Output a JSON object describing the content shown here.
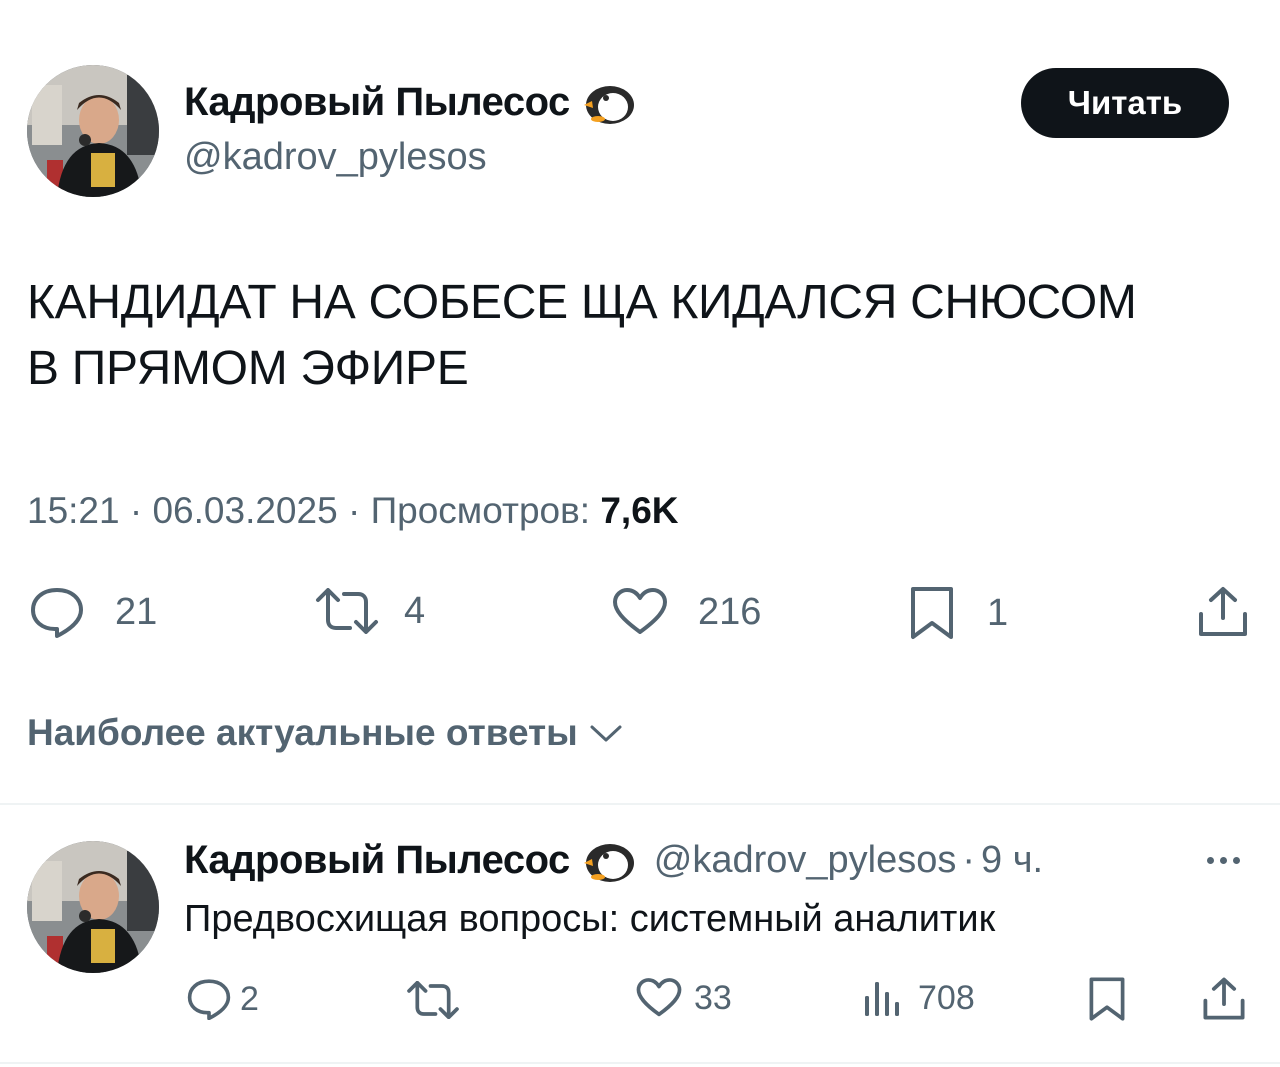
{
  "tweet": {
    "author": {
      "display_name": "Кадровый Пылесос",
      "handle": "@kadrov_pylesos",
      "badge_icon": "penguin-icon"
    },
    "follow_label": "Читать",
    "text_line1": "КАНДИДАТ НА СОБЕСЕ ЩА КИДАЛСЯ СНЮСОМ",
    "text_line2": "В ПРЯМОМ ЭФИРЕ",
    "time": "15:21",
    "separator": " · ",
    "date": "06.03.2025",
    "views_label": "Просмотров: ",
    "views_count": "7,6K",
    "actions": {
      "replies": "21",
      "retweets": "4",
      "likes": "216",
      "bookmarks": "1"
    }
  },
  "replies_sort": {
    "label": "Наиболее актуальные ответы"
  },
  "reply": {
    "author": {
      "display_name": "Кадровый Пылесос",
      "handle": "@kadrov_pylesos",
      "badge_icon": "penguin-icon"
    },
    "separator": "·",
    "time_ago": "9 ч.",
    "text": "Предвосхищая вопросы: системный аналитик",
    "actions": {
      "replies": "2",
      "likes": "33",
      "views": "708"
    }
  },
  "colors": {
    "text_primary": "#0f1419",
    "text_secondary": "#536471",
    "divider": "#eff3f4",
    "button_bg": "#0f1419",
    "button_text": "#ffffff"
  }
}
